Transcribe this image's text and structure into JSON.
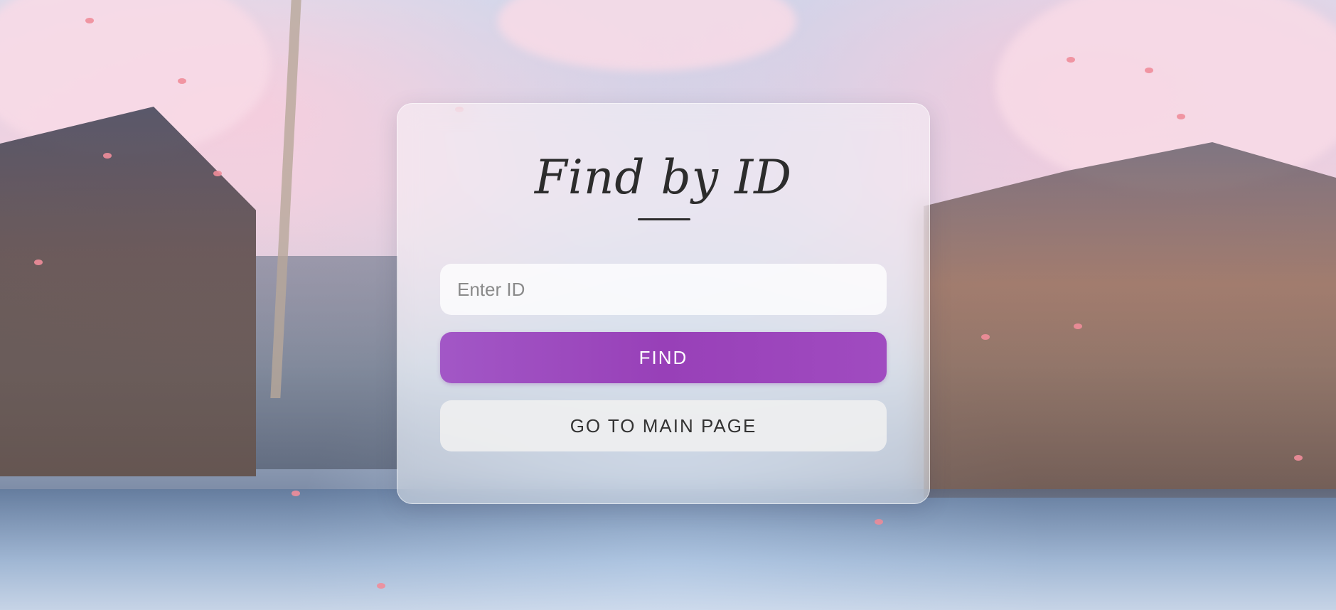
{
  "page": {
    "title": "Find by ID"
  },
  "form": {
    "id_placeholder": "Enter ID",
    "id_value": "",
    "find_label": "FIND",
    "main_page_label": "GO TO MAIN PAGE"
  },
  "colors": {
    "accent": "#9840b8",
    "secondary_button": "#f0f0f0",
    "title_text": "#2c2c2c"
  }
}
